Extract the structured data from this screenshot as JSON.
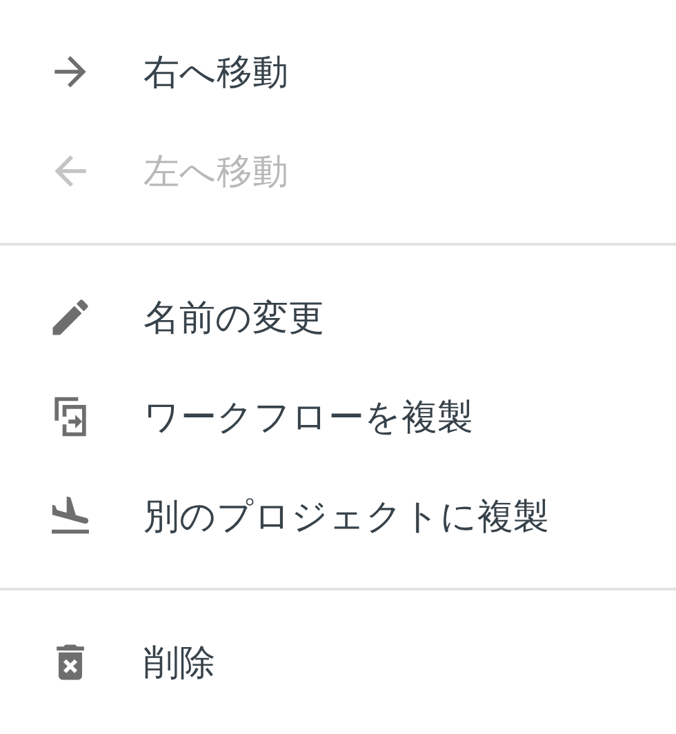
{
  "menu": {
    "groups": [
      {
        "items": [
          {
            "kind": "arrow-right",
            "label": "右へ移動",
            "disabled": false
          },
          {
            "kind": "arrow-left",
            "label": "左へ移動",
            "disabled": true
          }
        ]
      },
      {
        "items": [
          {
            "kind": "rename",
            "label": "名前の変更",
            "disabled": false
          },
          {
            "kind": "duplicate",
            "label": "ワークフローを複製",
            "disabled": false
          },
          {
            "kind": "copy-project",
            "label": "別のプロジェクトに複製",
            "disabled": false
          }
        ]
      },
      {
        "items": [
          {
            "kind": "delete",
            "label": "削除",
            "disabled": false
          }
        ]
      }
    ]
  }
}
